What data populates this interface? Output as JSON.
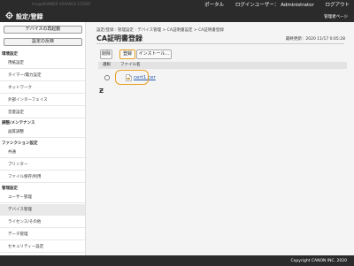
{
  "topbar": {
    "title": "ImageRUNNER ADVANCE C5560F",
    "portal_label": "ポータル",
    "login_user_label": "ログインユーザー：",
    "user_name": "Administrator",
    "logout_label": "ログアウト"
  },
  "header": {
    "section_title": "設定/登録",
    "portal_link": "管理者ページ"
  },
  "sidebar": {
    "restart_button": "デバイスの再起動",
    "change_button": "設定の反映",
    "groups": [
      {
        "heading": "環境設定",
        "items": [
          "用紙設定",
          "タイマー/電力設定",
          "ネットワーク",
          "外部インターフェイス",
          "音量設定"
        ]
      },
      {
        "heading": "調整/メンテナンス",
        "items": [
          "画質調整"
        ]
      },
      {
        "heading": "ファンクション設定",
        "items": [
          "共通",
          "プリンター",
          "ファイル保存/利用"
        ]
      },
      {
        "heading": "管理設定",
        "items": [
          "ユーザー管理",
          "デバイス管理",
          "ライセンス/その他",
          "データ管理",
          "セキュリティー設定"
        ]
      }
    ],
    "active_item": "デバイス管理"
  },
  "main": {
    "breadcrumb": "設定/登録 : 管理設定 : デバイス管理 > CA証明書設定 > CA証明書登録",
    "page_title": "CA証明書登録",
    "updated": "最終更新：2020 11/17 0:05:28",
    "toolbar": {
      "delete_label": "削除",
      "register_label": "登録",
      "install_label": "インストール..."
    },
    "table": {
      "col_select": "選択",
      "col_filename": "ファイル名",
      "rows": [
        {
          "filename": "cert1.cer"
        }
      ]
    }
  },
  "footer": {
    "copyright": "Copyright CANON INC. 2020"
  },
  "colors": {
    "chrome": "#2b2b2b",
    "highlight": "#e8a020",
    "link": "#2a5db0"
  }
}
